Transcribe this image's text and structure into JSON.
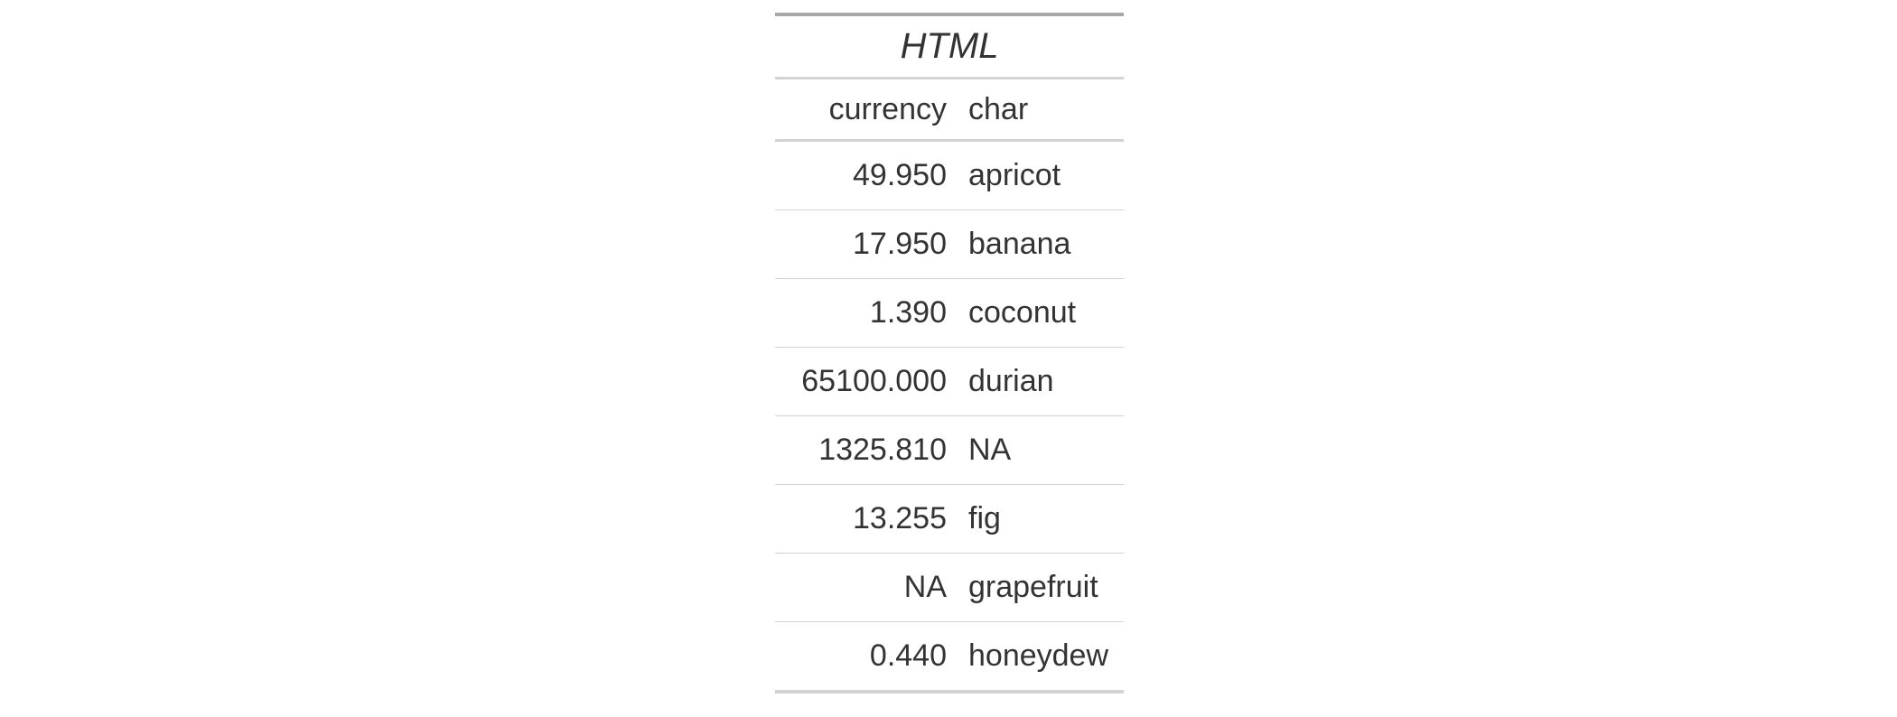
{
  "table": {
    "title": "HTML",
    "columns": [
      {
        "key": "currency",
        "label": "currency",
        "align": "right"
      },
      {
        "key": "char",
        "label": "char",
        "align": "left"
      }
    ],
    "rows": [
      {
        "currency": "49.950",
        "char": "apricot"
      },
      {
        "currency": "17.950",
        "char": "banana"
      },
      {
        "currency": "1.390",
        "char": "coconut"
      },
      {
        "currency": "65100.000",
        "char": "durian"
      },
      {
        "currency": "1325.810",
        "char": "NA"
      },
      {
        "currency": "13.255",
        "char": "fig"
      },
      {
        "currency": "NA",
        "char": "grapefruit"
      },
      {
        "currency": "0.440",
        "char": "honeydew"
      }
    ]
  },
  "colors": {
    "text": "#333333",
    "top_border": "#A8A8A8",
    "rule": "#D3D3D3",
    "background": "#FFFFFF"
  }
}
